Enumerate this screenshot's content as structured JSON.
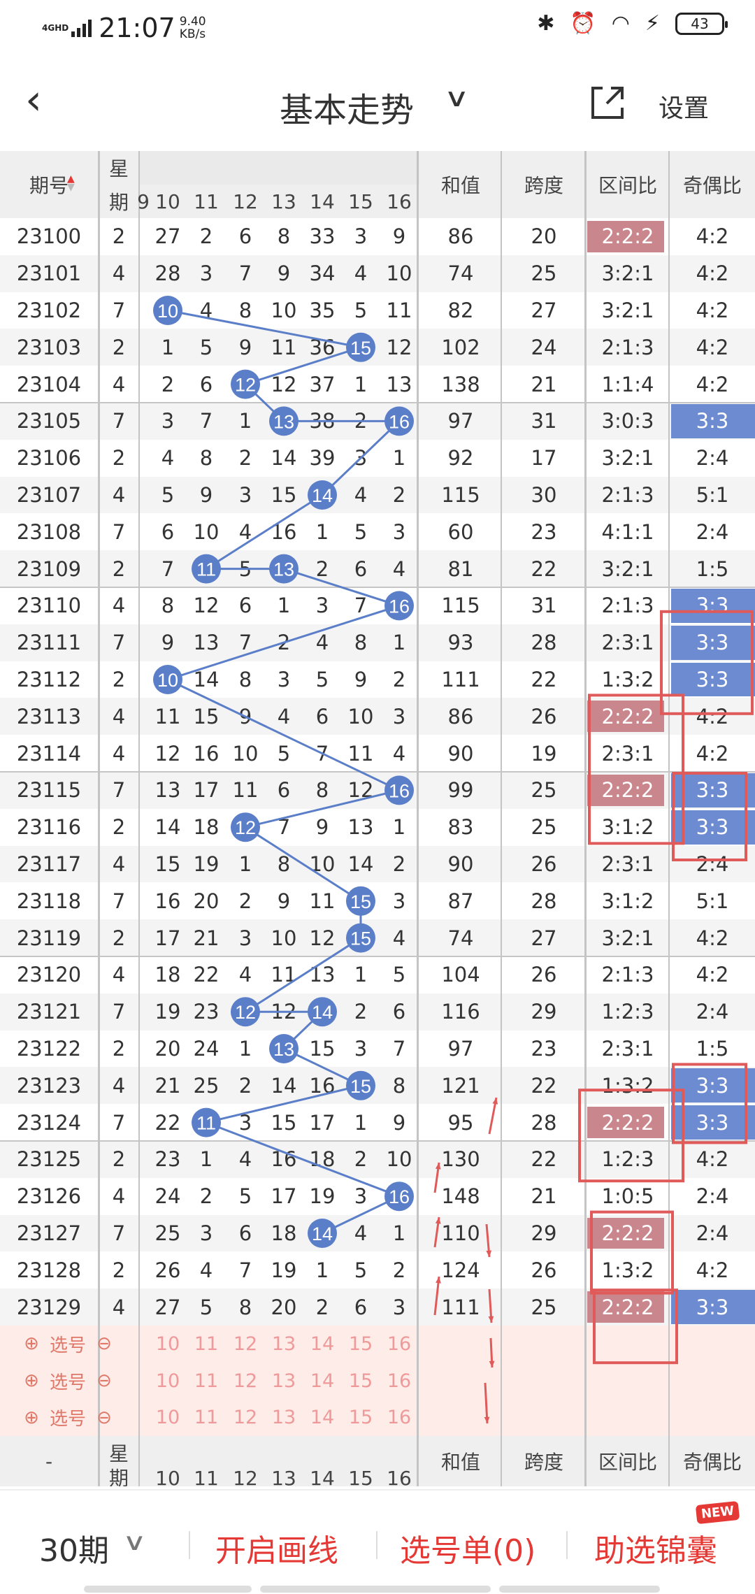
{
  "status_bar": {
    "network": "4GHD",
    "time": "21:07",
    "speed": "9.40",
    "speed_unit": "KB/s",
    "battery": "43"
  },
  "nav": {
    "back": "‹",
    "title": "基本走势",
    "settings": "设置"
  },
  "table": {
    "headers": {
      "period": "期号",
      "weekday_top": "星",
      "weekday_bottom": "期",
      "sum": "和值",
      "span": "跨度",
      "range_ratio": "区间比",
      "parity_ratio": "奇偶比"
    },
    "partial_col_label": "9",
    "numbers_header": [
      "10",
      "11",
      "12",
      "13",
      "14",
      "15",
      "16"
    ],
    "rows": [
      {
        "period": "23100",
        "weekday": "2",
        "nums": [
          "27",
          "2",
          "6",
          "8",
          "33",
          "3",
          "9"
        ],
        "sum": "86",
        "span": "20",
        "range": "2:2:2",
        "parity": "4:2",
        "range_hl": true,
        "parity_hl": false
      },
      {
        "period": "23101",
        "weekday": "4",
        "nums": [
          "28",
          "3",
          "7",
          "9",
          "34",
          "4",
          "10"
        ],
        "sum": "74",
        "span": "25",
        "range": "3:2:1",
        "parity": "4:2",
        "range_hl": false,
        "parity_hl": false
      },
      {
        "period": "23102",
        "weekday": "7",
        "nums": [
          "10",
          "4",
          "8",
          "10",
          "35",
          "5",
          "11"
        ],
        "sum": "82",
        "span": "27",
        "range": "3:2:1",
        "parity": "4:2",
        "range_hl": false,
        "parity_hl": false
      },
      {
        "period": "23103",
        "weekday": "2",
        "nums": [
          "1",
          "5",
          "9",
          "11",
          "36",
          "15",
          "12"
        ],
        "sum": "102",
        "span": "24",
        "range": "2:1:3",
        "parity": "4:2",
        "range_hl": false,
        "parity_hl": false
      },
      {
        "period": "23104",
        "weekday": "4",
        "nums": [
          "2",
          "6",
          "12",
          "12",
          "37",
          "1",
          "13"
        ],
        "sum": "138",
        "span": "21",
        "range": "1:1:4",
        "parity": "4:2",
        "range_hl": false,
        "parity_hl": false
      },
      {
        "period": "23105",
        "weekday": "7",
        "nums": [
          "3",
          "7",
          "1",
          "13",
          "38",
          "2",
          "16"
        ],
        "sum": "97",
        "span": "31",
        "range": "3:0:3",
        "parity": "3:3",
        "range_hl": false,
        "parity_hl": true
      },
      {
        "period": "23106",
        "weekday": "2",
        "nums": [
          "4",
          "8",
          "2",
          "14",
          "39",
          "3",
          "1"
        ],
        "sum": "92",
        "span": "17",
        "range": "3:2:1",
        "parity": "2:4",
        "range_hl": false,
        "parity_hl": false
      },
      {
        "period": "23107",
        "weekday": "4",
        "nums": [
          "5",
          "9",
          "3",
          "15",
          "14",
          "4",
          "2"
        ],
        "sum": "115",
        "span": "30",
        "range": "2:1:3",
        "parity": "5:1",
        "range_hl": false,
        "parity_hl": false
      },
      {
        "period": "23108",
        "weekday": "7",
        "nums": [
          "6",
          "10",
          "4",
          "16",
          "1",
          "5",
          "3"
        ],
        "sum": "60",
        "span": "23",
        "range": "4:1:1",
        "parity": "2:4",
        "range_hl": false,
        "parity_hl": false
      },
      {
        "period": "23109",
        "weekday": "2",
        "nums": [
          "7",
          "11",
          "5",
          "13",
          "2",
          "6",
          "4"
        ],
        "sum": "81",
        "span": "22",
        "range": "3:2:1",
        "parity": "1:5",
        "range_hl": false,
        "parity_hl": false
      },
      {
        "period": "23110",
        "weekday": "4",
        "nums": [
          "8",
          "12",
          "6",
          "1",
          "3",
          "7",
          "16"
        ],
        "sum": "115",
        "span": "31",
        "range": "2:1:3",
        "parity": "3:3",
        "range_hl": false,
        "parity_hl": true
      },
      {
        "period": "23111",
        "weekday": "7",
        "nums": [
          "9",
          "13",
          "7",
          "2",
          "4",
          "8",
          "1"
        ],
        "sum": "93",
        "span": "28",
        "range": "2:3:1",
        "parity": "3:3",
        "range_hl": false,
        "parity_hl": true
      },
      {
        "period": "23112",
        "weekday": "2",
        "nums": [
          "10",
          "14",
          "8",
          "3",
          "5",
          "9",
          "2"
        ],
        "sum": "111",
        "span": "22",
        "range": "1:3:2",
        "parity": "3:3",
        "range_hl": false,
        "parity_hl": true
      },
      {
        "period": "23113",
        "weekday": "4",
        "nums": [
          "11",
          "15",
          "9",
          "4",
          "6",
          "10",
          "3"
        ],
        "sum": "86",
        "span": "26",
        "range": "2:2:2",
        "parity": "4:2",
        "range_hl": true,
        "parity_hl": false
      },
      {
        "period": "23114",
        "weekday": "4",
        "nums": [
          "12",
          "16",
          "10",
          "5",
          "7",
          "11",
          "4"
        ],
        "sum": "90",
        "span": "19",
        "range": "2:3:1",
        "parity": "4:2",
        "range_hl": false,
        "parity_hl": false
      },
      {
        "period": "23115",
        "weekday": "7",
        "nums": [
          "13",
          "17",
          "11",
          "6",
          "8",
          "12",
          "16"
        ],
        "sum": "99",
        "span": "25",
        "range": "2:2:2",
        "parity": "3:3",
        "range_hl": true,
        "parity_hl": true
      },
      {
        "period": "23116",
        "weekday": "2",
        "nums": [
          "14",
          "18",
          "12",
          "7",
          "9",
          "13",
          "1"
        ],
        "sum": "83",
        "span": "25",
        "range": "3:1:2",
        "parity": "3:3",
        "range_hl": false,
        "parity_hl": true
      },
      {
        "period": "23117",
        "weekday": "4",
        "nums": [
          "15",
          "19",
          "1",
          "8",
          "10",
          "14",
          "2"
        ],
        "sum": "90",
        "span": "26",
        "range": "2:3:1",
        "parity": "2:4",
        "range_hl": false,
        "parity_hl": false
      },
      {
        "period": "23118",
        "weekday": "7",
        "nums": [
          "16",
          "20",
          "2",
          "9",
          "11",
          "15",
          "3"
        ],
        "sum": "87",
        "span": "28",
        "range": "3:1:2",
        "parity": "5:1",
        "range_hl": false,
        "parity_hl": false
      },
      {
        "period": "23119",
        "weekday": "2",
        "nums": [
          "17",
          "21",
          "3",
          "10",
          "12",
          "15",
          "4"
        ],
        "sum": "74",
        "span": "27",
        "range": "3:2:1",
        "parity": "4:2",
        "range_hl": false,
        "parity_hl": false
      },
      {
        "period": "23120",
        "weekday": "4",
        "nums": [
          "18",
          "22",
          "4",
          "11",
          "13",
          "1",
          "5"
        ],
        "sum": "104",
        "span": "26",
        "range": "2:1:3",
        "parity": "4:2",
        "range_hl": false,
        "parity_hl": false
      },
      {
        "period": "23121",
        "weekday": "7",
        "nums": [
          "19",
          "23",
          "12",
          "12",
          "14",
          "2",
          "6"
        ],
        "sum": "116",
        "span": "29",
        "range": "1:2:3",
        "parity": "2:4",
        "range_hl": false,
        "parity_hl": false
      },
      {
        "period": "23122",
        "weekday": "2",
        "nums": [
          "20",
          "24",
          "1",
          "13",
          "15",
          "3",
          "7"
        ],
        "sum": "97",
        "span": "23",
        "range": "2:3:1",
        "parity": "1:5",
        "range_hl": false,
        "parity_hl": false
      },
      {
        "period": "23123",
        "weekday": "4",
        "nums": [
          "21",
          "25",
          "2",
          "14",
          "16",
          "15",
          "8"
        ],
        "sum": "121",
        "span": "22",
        "range": "1:3:2",
        "parity": "3:3",
        "range_hl": false,
        "parity_hl": true
      },
      {
        "period": "23124",
        "weekday": "7",
        "nums": [
          "22",
          "11",
          "3",
          "15",
          "17",
          "1",
          "9"
        ],
        "sum": "95",
        "span": "28",
        "range": "2:2:2",
        "parity": "3:3",
        "range_hl": true,
        "parity_hl": true
      },
      {
        "period": "23125",
        "weekday": "2",
        "nums": [
          "23",
          "1",
          "4",
          "16",
          "18",
          "2",
          "10"
        ],
        "sum": "130",
        "span": "22",
        "range": "1:2:3",
        "parity": "4:2",
        "range_hl": false,
        "parity_hl": false
      },
      {
        "period": "23126",
        "weekday": "4",
        "nums": [
          "24",
          "2",
          "5",
          "17",
          "19",
          "3",
          "16"
        ],
        "sum": "148",
        "span": "21",
        "range": "1:0:5",
        "parity": "2:4",
        "range_hl": false,
        "parity_hl": false
      },
      {
        "period": "23127",
        "weekday": "7",
        "nums": [
          "25",
          "3",
          "6",
          "18",
          "14",
          "4",
          "1"
        ],
        "sum": "110",
        "span": "29",
        "range": "2:2:2",
        "parity": "2:4",
        "range_hl": true,
        "parity_hl": false
      },
      {
        "period": "23128",
        "weekday": "2",
        "nums": [
          "26",
          "4",
          "7",
          "19",
          "1",
          "5",
          "2"
        ],
        "sum": "124",
        "span": "26",
        "range": "1:3:2",
        "parity": "4:2",
        "range_hl": false,
        "parity_hl": false
      },
      {
        "period": "23129",
        "weekday": "4",
        "nums": [
          "27",
          "5",
          "8",
          "20",
          "2",
          "6",
          "3"
        ],
        "sum": "111",
        "span": "25",
        "range": "2:2:2",
        "parity": "3:3",
        "range_hl": true,
        "parity_hl": true
      }
    ],
    "pick_rows": [
      {
        "label": "选号",
        "nums": [
          "10",
          "11",
          "12",
          "13",
          "14",
          "15",
          "16"
        ]
      },
      {
        "label": "选号",
        "nums": [
          "10",
          "11",
          "12",
          "13",
          "14",
          "15",
          "16"
        ]
      },
      {
        "label": "选号",
        "nums": [
          "10",
          "11",
          "12",
          "13",
          "14",
          "15",
          "16"
        ]
      }
    ],
    "footer": {
      "period": "-",
      "weekday_top": "星",
      "weekday_bottom": "期",
      "sum": "和值",
      "span": "跨度",
      "range_ratio": "区间比",
      "parity_ratio": "奇偶比",
      "numbers": [
        "10",
        "11",
        "12",
        "13",
        "14",
        "15",
        "16"
      ]
    }
  },
  "toolbar": {
    "periods": "30期",
    "draw_lines": "开启画线",
    "pick_list": "选号单(0)",
    "helper": "助选锦囊",
    "new_badge": "NEW"
  },
  "colors": {
    "ball": "#5b7ec9",
    "range_highlight": "#c9868c",
    "parity_highlight": "#6d8bd1",
    "annotation": "#e05a5a",
    "accent": "#e53935"
  }
}
